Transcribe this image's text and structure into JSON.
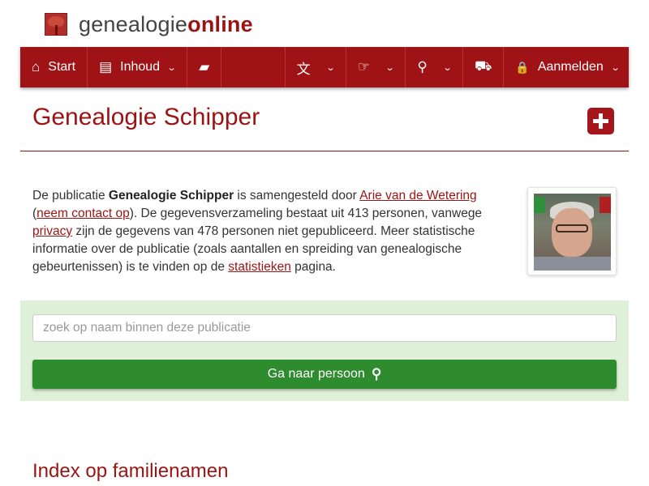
{
  "brand": {
    "name_part1": "genealogie",
    "name_part2": "online",
    "logo_icon": "tree-icon"
  },
  "nav": {
    "start_label": "Start",
    "inhoud_label": "Inhoud",
    "login_label": "Aanmelden",
    "icons": {
      "start": "home-icon",
      "inhoud": "book-icon",
      "chat": "comments-icon",
      "language": "translate-icon",
      "share": "hand-point-icon",
      "search": "search-icon",
      "cart": "cart-icon",
      "login": "lock-icon",
      "dropdown": "chevron-down-icon"
    },
    "glyphs": {
      "home": "⌂",
      "book": "▤",
      "chat": "▰",
      "language": "文",
      "share": "☞",
      "search": "⚲",
      "cart": "⛟",
      "lock": "🔒",
      "chevron": "⌄"
    }
  },
  "page": {
    "title": "Genealogie Schipper",
    "add_icon": "plus-square-icon"
  },
  "intro": {
    "t1": "De publicatie ",
    "pub_name": "Genealogie Schipper",
    "t2": " is samengesteld door ",
    "author_link": "Arie van de Wetering",
    "t3": " (",
    "contact_link": "neem contact op",
    "t4": "). De gegevensverzameling bestaat uit 413 personen, vanwege ",
    "privacy_link": "privacy",
    "t5": " zijn de gegevens van 478 personen niet gepubliceerd. Meer statistische informatie over de publicatie (zoals aantallen en spreiding van genealogische gebeurtenissen) is te vinden op de ",
    "stats_link": "statistieken",
    "t6": " pagina."
  },
  "search": {
    "placeholder": "zoek op naam binnen deze publicatie",
    "button_label": "Ga naar persoon",
    "button_icon": "search-icon"
  },
  "section": {
    "index_title": "Index op familienamen"
  },
  "colors": {
    "brand_red": "#9f1216",
    "panel_green": "#dff0d8",
    "button_green": "#2e8b2e"
  }
}
